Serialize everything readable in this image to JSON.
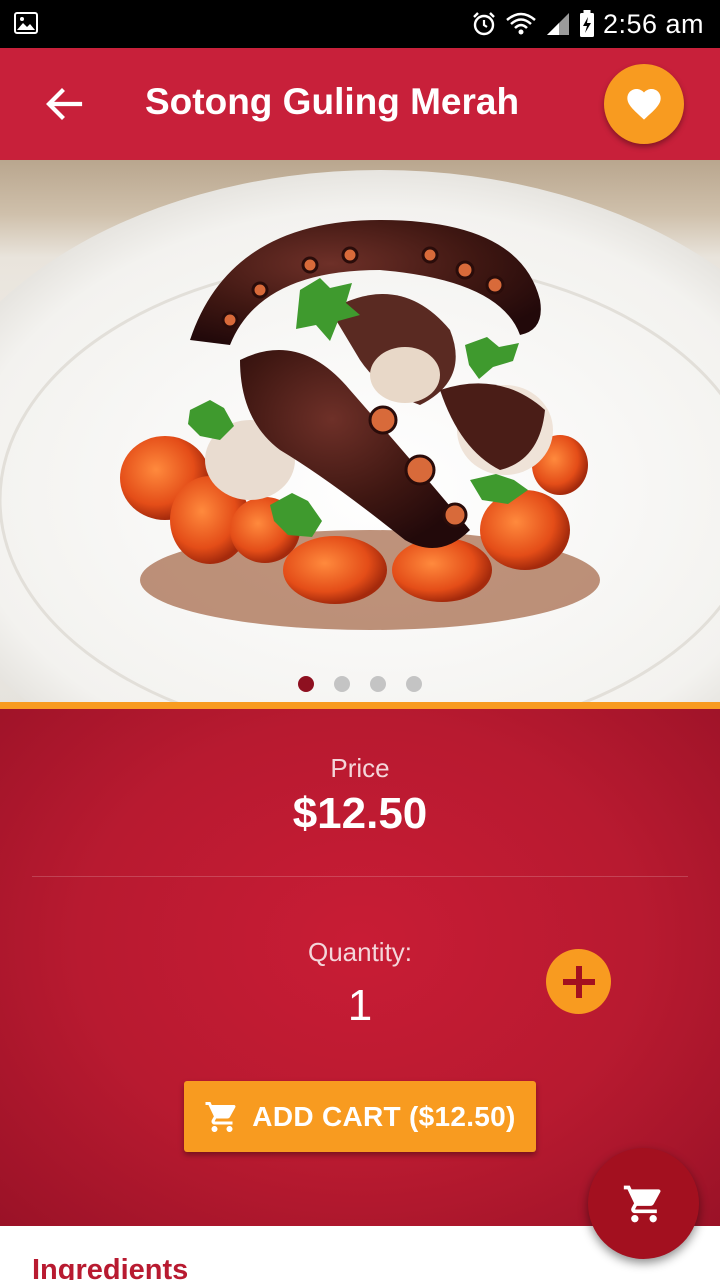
{
  "status_bar": {
    "time": "2:56 am"
  },
  "app_bar": {
    "title": "Sotong Guling Merah"
  },
  "carousel": {
    "total_dots": 4,
    "active_index": 0
  },
  "product": {
    "price_label": "Price",
    "price_value": "$12.50",
    "quantity_label": "Quantity:",
    "quantity_value": "1"
  },
  "actions": {
    "add_cart_label": "ADD CART ($12.50)"
  },
  "ingredients": {
    "title": "Ingredients"
  },
  "colors": {
    "primary": "#c8203a",
    "accent": "#f89b20",
    "fab": "#a3101f"
  },
  "icons": {
    "back": "arrow-left-icon",
    "favorite": "heart-icon",
    "increase": "plus-icon",
    "cart": "shopping-cart-icon"
  }
}
